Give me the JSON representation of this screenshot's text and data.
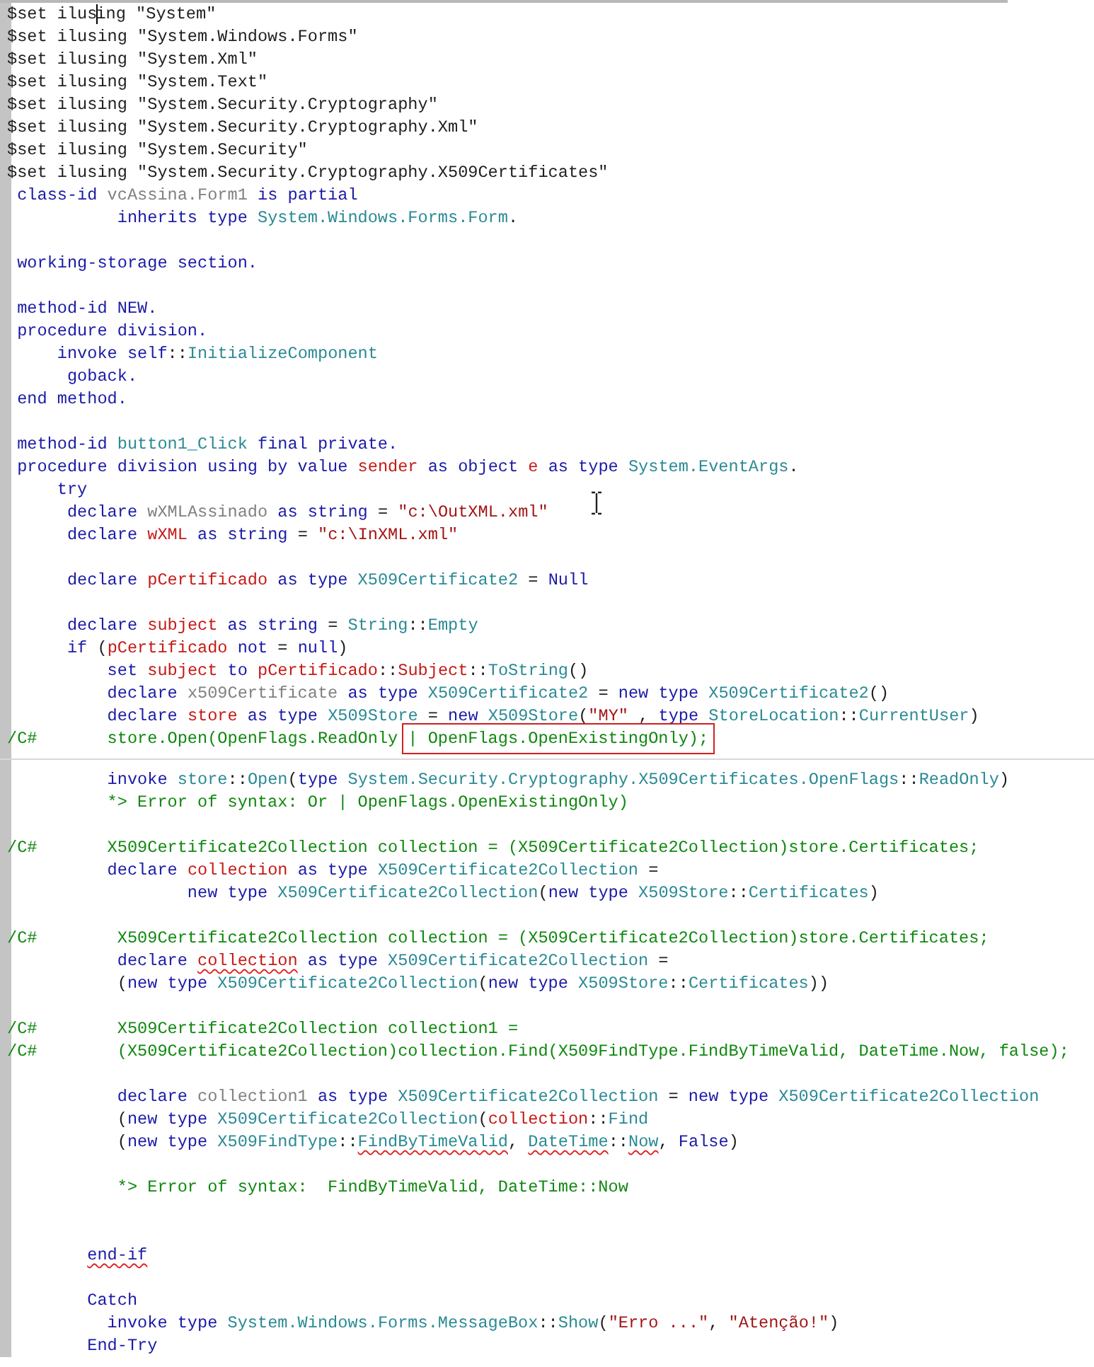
{
  "lines": [
    {
      "kind": "code",
      "tokens": [
        {
          "kind": "plain",
          "text": "$set ilus",
          "caret": true
        },
        {
          "kind": "plain",
          "text": "ing \"System\""
        }
      ]
    },
    {
      "kind": "code",
      "tokens": [
        {
          "kind": "plain",
          "text": "$set ilusing \"System.Windows.Forms\""
        }
      ]
    },
    {
      "kind": "code",
      "tokens": [
        {
          "kind": "plain",
          "text": "$set ilusing \"System.Xml\""
        }
      ]
    },
    {
      "kind": "code",
      "tokens": [
        {
          "kind": "plain",
          "text": "$set ilusing \"System.Text\""
        }
      ]
    },
    {
      "kind": "code",
      "tokens": [
        {
          "kind": "plain",
          "text": "$set ilusing \"System.Security.Cryptography\""
        }
      ]
    },
    {
      "kind": "code",
      "tokens": [
        {
          "kind": "plain",
          "text": "$set ilusing \"System.Security.Cryptography.Xml\""
        }
      ]
    },
    {
      "kind": "code",
      "tokens": [
        {
          "kind": "plain",
          "text": "$set ilusing \"System.Security\""
        }
      ]
    },
    {
      "kind": "code",
      "tokens": [
        {
          "kind": "plain",
          "text": "$set ilusing \"System.Security.Cryptography.X509Certificates\""
        }
      ]
    },
    {
      "kind": "code",
      "tokens": [
        {
          "kind": "keyword",
          "text": " class-id "
        },
        {
          "kind": "muted",
          "text": "vcAssina.Form1"
        },
        {
          "kind": "keyword",
          "text": " is partial"
        }
      ]
    },
    {
      "kind": "code",
      "tokens": [
        {
          "kind": "keyword",
          "text": "           inherits type "
        },
        {
          "kind": "type",
          "text": "System.Windows.Forms.Form"
        },
        {
          "kind": "plain",
          "text": "."
        }
      ]
    },
    {
      "kind": "blank"
    },
    {
      "kind": "code",
      "tokens": [
        {
          "kind": "keyword",
          "text": " working-storage section."
        }
      ]
    },
    {
      "kind": "blank"
    },
    {
      "kind": "code",
      "tokens": [
        {
          "kind": "keyword",
          "text": " method-id NEW."
        }
      ]
    },
    {
      "kind": "code",
      "tokens": [
        {
          "kind": "keyword",
          "text": " procedure division."
        }
      ]
    },
    {
      "kind": "code",
      "tokens": [
        {
          "kind": "keyword",
          "text": "     invoke self"
        },
        {
          "kind": "plain",
          "text": "::"
        },
        {
          "kind": "type",
          "text": "InitializeComponent"
        }
      ]
    },
    {
      "kind": "code",
      "tokens": [
        {
          "kind": "keyword",
          "text": "      goback."
        }
      ]
    },
    {
      "kind": "code",
      "tokens": [
        {
          "kind": "keyword",
          "text": " end method."
        }
      ]
    },
    {
      "kind": "blank"
    },
    {
      "kind": "code",
      "tokens": [
        {
          "kind": "keyword",
          "text": " method-id "
        },
        {
          "kind": "type",
          "text": "button1_Click"
        },
        {
          "kind": "keyword",
          "text": " final private."
        }
      ]
    },
    {
      "kind": "code",
      "tokens": [
        {
          "kind": "keyword",
          "text": " procedure division using by value "
        },
        {
          "kind": "variable",
          "text": "sender"
        },
        {
          "kind": "keyword",
          "text": " as object "
        },
        {
          "kind": "variable",
          "text": "e"
        },
        {
          "kind": "keyword",
          "text": " as type "
        },
        {
          "kind": "type",
          "text": "System.EventArgs"
        },
        {
          "kind": "plain",
          "text": "."
        }
      ]
    },
    {
      "kind": "code",
      "tokens": [
        {
          "kind": "keyword",
          "text": "     try"
        }
      ]
    },
    {
      "kind": "code",
      "tokens": [
        {
          "kind": "keyword",
          "text": "      declare "
        },
        {
          "kind": "muted",
          "text": "wXMLAssinado"
        },
        {
          "kind": "keyword",
          "text": " as string "
        },
        {
          "kind": "plain",
          "text": "= "
        },
        {
          "kind": "string",
          "text": "\"c:\\OutXML.xml\""
        }
      ]
    },
    {
      "kind": "code",
      "tokens": [
        {
          "kind": "keyword",
          "text": "      declare "
        },
        {
          "kind": "variable",
          "text": "wXML"
        },
        {
          "kind": "keyword",
          "text": " as string "
        },
        {
          "kind": "plain",
          "text": "= "
        },
        {
          "kind": "string",
          "text": "\"c:\\InXML.xml\""
        }
      ]
    },
    {
      "kind": "blank"
    },
    {
      "kind": "code",
      "tokens": [
        {
          "kind": "keyword",
          "text": "      declare "
        },
        {
          "kind": "variable",
          "text": "pCertificado"
        },
        {
          "kind": "keyword",
          "text": " as type "
        },
        {
          "kind": "type",
          "text": "X509Certificate2"
        },
        {
          "kind": "plain",
          "text": " = "
        },
        {
          "kind": "keyword",
          "text": "Null"
        }
      ]
    },
    {
      "kind": "blank"
    },
    {
      "kind": "code",
      "tokens": [
        {
          "kind": "keyword",
          "text": "      declare "
        },
        {
          "kind": "variable",
          "text": "subject"
        },
        {
          "kind": "keyword",
          "text": " as string "
        },
        {
          "kind": "plain",
          "text": "= "
        },
        {
          "kind": "type",
          "text": "String"
        },
        {
          "kind": "plain",
          "text": "::"
        },
        {
          "kind": "type",
          "text": "Empty"
        }
      ]
    },
    {
      "kind": "code",
      "tokens": [
        {
          "kind": "keyword",
          "text": "      if "
        },
        {
          "kind": "plain",
          "text": "("
        },
        {
          "kind": "variable",
          "text": "pCertificado"
        },
        {
          "kind": "keyword",
          "text": " not "
        },
        {
          "kind": "plain",
          "text": "= "
        },
        {
          "kind": "keyword",
          "text": "null"
        },
        {
          "kind": "plain",
          "text": ")"
        }
      ]
    },
    {
      "kind": "code",
      "tokens": [
        {
          "kind": "keyword",
          "text": "          set "
        },
        {
          "kind": "variable",
          "text": "subject"
        },
        {
          "kind": "keyword",
          "text": " to "
        },
        {
          "kind": "variable",
          "text": "pCertificado"
        },
        {
          "kind": "plain",
          "text": "::"
        },
        {
          "kind": "variable",
          "text": "Subject"
        },
        {
          "kind": "plain",
          "text": "::"
        },
        {
          "kind": "type",
          "text": "ToString"
        },
        {
          "kind": "plain",
          "text": "()"
        }
      ]
    },
    {
      "kind": "code",
      "tokens": [
        {
          "kind": "keyword",
          "text": "          declare "
        },
        {
          "kind": "muted",
          "text": "x509Certificate"
        },
        {
          "kind": "keyword",
          "text": " as type "
        },
        {
          "kind": "type",
          "text": "X509Certificate2"
        },
        {
          "kind": "plain",
          "text": " = "
        },
        {
          "kind": "keyword",
          "text": "new type "
        },
        {
          "kind": "type",
          "text": "X509Certificate2"
        },
        {
          "kind": "plain",
          "text": "()"
        }
      ]
    },
    {
      "kind": "code",
      "tokens": [
        {
          "kind": "keyword",
          "text": "          declare "
        },
        {
          "kind": "variable",
          "text": "store"
        },
        {
          "kind": "keyword",
          "text": " as type "
        },
        {
          "kind": "type",
          "text": "X509Store"
        },
        {
          "kind": "plain",
          "text": " = "
        },
        {
          "kind": "keyword",
          "text": "new "
        },
        {
          "kind": "type",
          "text": "X509Store"
        },
        {
          "kind": "plain",
          "text": "("
        },
        {
          "kind": "string",
          "text": "\"MY\""
        },
        {
          "kind": "plain",
          "text": " , "
        },
        {
          "kind": "keyword",
          "text": "type "
        },
        {
          "kind": "type",
          "text": "StoreLocation"
        },
        {
          "kind": "plain",
          "text": "::"
        },
        {
          "kind": "type",
          "text": "CurrentUser"
        },
        {
          "kind": "plain",
          "text": ")"
        }
      ]
    },
    {
      "kind": "code",
      "tokens": [
        {
          "kind": "comment",
          "text": "/C#       store.Open(OpenFlags.ReadOnly "
        },
        {
          "kind": "comment",
          "text": "| OpenFlags.OpenExistingOnly);",
          "boxed": true
        }
      ]
    },
    {
      "kind": "divider"
    },
    {
      "kind": "code",
      "tokens": [
        {
          "kind": "keyword",
          "text": "          invoke "
        },
        {
          "kind": "type",
          "text": "store"
        },
        {
          "kind": "plain",
          "text": "::"
        },
        {
          "kind": "type",
          "text": "Open"
        },
        {
          "kind": "plain",
          "text": "("
        },
        {
          "kind": "keyword",
          "text": "type "
        },
        {
          "kind": "type",
          "text": "System.Security.Cryptography.X509Certificates.OpenFlags"
        },
        {
          "kind": "plain",
          "text": "::"
        },
        {
          "kind": "type",
          "text": "ReadOnly"
        },
        {
          "kind": "plain",
          "text": ")"
        }
      ]
    },
    {
      "kind": "code",
      "tokens": [
        {
          "kind": "comment",
          "text": "          *> Error of syntax: Or | OpenFlags.OpenExistingOnly)"
        }
      ]
    },
    {
      "kind": "blank"
    },
    {
      "kind": "code",
      "tokens": [
        {
          "kind": "comment",
          "text": "/C#       X509Certificate2Collection collection = (X509Certificate2Collection)store.Certificates;"
        }
      ]
    },
    {
      "kind": "code",
      "tokens": [
        {
          "kind": "keyword",
          "text": "          declare "
        },
        {
          "kind": "variable",
          "text": "collection"
        },
        {
          "kind": "keyword",
          "text": " as type "
        },
        {
          "kind": "type",
          "text": "X509Certificate2Collection"
        },
        {
          "kind": "plain",
          "text": " ="
        }
      ]
    },
    {
      "kind": "code",
      "tokens": [
        {
          "kind": "keyword",
          "text": "                  new type "
        },
        {
          "kind": "type",
          "text": "X509Certificate2Collection"
        },
        {
          "kind": "plain",
          "text": "("
        },
        {
          "kind": "keyword",
          "text": "new type "
        },
        {
          "kind": "type",
          "text": "X509Store"
        },
        {
          "kind": "plain",
          "text": "::"
        },
        {
          "kind": "type",
          "text": "Certificates"
        },
        {
          "kind": "plain",
          "text": ")"
        }
      ]
    },
    {
      "kind": "blank"
    },
    {
      "kind": "code",
      "tokens": [
        {
          "kind": "comment",
          "text": "/C#        X509Certificate2Collection collection = (X509Certificate2Collection)store.Certificates;"
        }
      ]
    },
    {
      "kind": "code",
      "tokens": [
        {
          "kind": "keyword",
          "text": "           declare "
        },
        {
          "kind": "variable",
          "text": "collection",
          "squiggle": true
        },
        {
          "kind": "keyword",
          "text": " as type "
        },
        {
          "kind": "type",
          "text": "X509Certificate2Collection"
        },
        {
          "kind": "plain",
          "text": " ="
        }
      ]
    },
    {
      "kind": "code",
      "tokens": [
        {
          "kind": "plain",
          "text": "           ("
        },
        {
          "kind": "keyword",
          "text": "new type "
        },
        {
          "kind": "type",
          "text": "X509Certificate2Collection"
        },
        {
          "kind": "plain",
          "text": "("
        },
        {
          "kind": "keyword",
          "text": "new type "
        },
        {
          "kind": "type",
          "text": "X509Store"
        },
        {
          "kind": "plain",
          "text": "::"
        },
        {
          "kind": "type",
          "text": "Certificates"
        },
        {
          "kind": "plain",
          "text": "))"
        }
      ]
    },
    {
      "kind": "blank"
    },
    {
      "kind": "code",
      "tokens": [
        {
          "kind": "comment",
          "text": "/C#        X509Certificate2Collection collection1 ="
        }
      ]
    },
    {
      "kind": "code",
      "tokens": [
        {
          "kind": "comment",
          "text": "/C#        (X509Certificate2Collection)collection.Find(X509FindType.FindByTimeValid, DateTime.Now, false);"
        }
      ]
    },
    {
      "kind": "blank"
    },
    {
      "kind": "code",
      "tokens": [
        {
          "kind": "keyword",
          "text": "           declare "
        },
        {
          "kind": "muted",
          "text": "collection1"
        },
        {
          "kind": "keyword",
          "text": " as type "
        },
        {
          "kind": "type",
          "text": "X509Certificate2Collection"
        },
        {
          "kind": "plain",
          "text": " = "
        },
        {
          "kind": "keyword",
          "text": "new type "
        },
        {
          "kind": "type",
          "text": "X509Certificate2Collection"
        }
      ]
    },
    {
      "kind": "code",
      "tokens": [
        {
          "kind": "plain",
          "text": "           ("
        },
        {
          "kind": "keyword",
          "text": "new type "
        },
        {
          "kind": "type",
          "text": "X509Certificate2Collection"
        },
        {
          "kind": "plain",
          "text": "("
        },
        {
          "kind": "variable",
          "text": "collection"
        },
        {
          "kind": "plain",
          "text": "::"
        },
        {
          "kind": "type",
          "text": "Find"
        }
      ]
    },
    {
      "kind": "code",
      "tokens": [
        {
          "kind": "plain",
          "text": "           ("
        },
        {
          "kind": "keyword",
          "text": "new type "
        },
        {
          "kind": "type",
          "text": "X509FindType"
        },
        {
          "kind": "plain",
          "text": "::"
        },
        {
          "kind": "type",
          "text": "FindByTimeValid",
          "squiggle": true
        },
        {
          "kind": "plain",
          "text": ", "
        },
        {
          "kind": "type",
          "text": "DateTime",
          "squiggle": true
        },
        {
          "kind": "plain",
          "text": "::"
        },
        {
          "kind": "type",
          "text": "Now",
          "squiggle": true
        },
        {
          "kind": "plain",
          "text": ", "
        },
        {
          "kind": "keyword",
          "text": "False"
        },
        {
          "kind": "plain",
          "text": ")"
        }
      ]
    },
    {
      "kind": "blank"
    },
    {
      "kind": "code",
      "tokens": [
        {
          "kind": "comment",
          "text": "           *> Error of syntax:  FindByTimeValid, DateTime::Now"
        }
      ]
    },
    {
      "kind": "blank"
    },
    {
      "kind": "blank"
    },
    {
      "kind": "code",
      "tokens": [
        {
          "kind": "keyword",
          "text": "        end-if",
          "squiggle": true
        }
      ]
    },
    {
      "kind": "blank"
    },
    {
      "kind": "code",
      "tokens": [
        {
          "kind": "keyword",
          "text": "        Catch"
        }
      ]
    },
    {
      "kind": "code",
      "tokens": [
        {
          "kind": "keyword",
          "text": "          invoke type "
        },
        {
          "kind": "type",
          "text": "System.Windows.Forms.MessageBox"
        },
        {
          "kind": "plain",
          "text": "::"
        },
        {
          "kind": "type",
          "text": "Show"
        },
        {
          "kind": "plain",
          "text": "("
        },
        {
          "kind": "string",
          "text": "\"Erro ...\""
        },
        {
          "kind": "plain",
          "text": ", "
        },
        {
          "kind": "string",
          "text": "\"Atenção!\""
        },
        {
          "kind": "plain",
          "text": ")"
        }
      ]
    },
    {
      "kind": "code",
      "tokens": [
        {
          "kind": "keyword",
          "text": "        End-Try"
        }
      ]
    }
  ]
}
